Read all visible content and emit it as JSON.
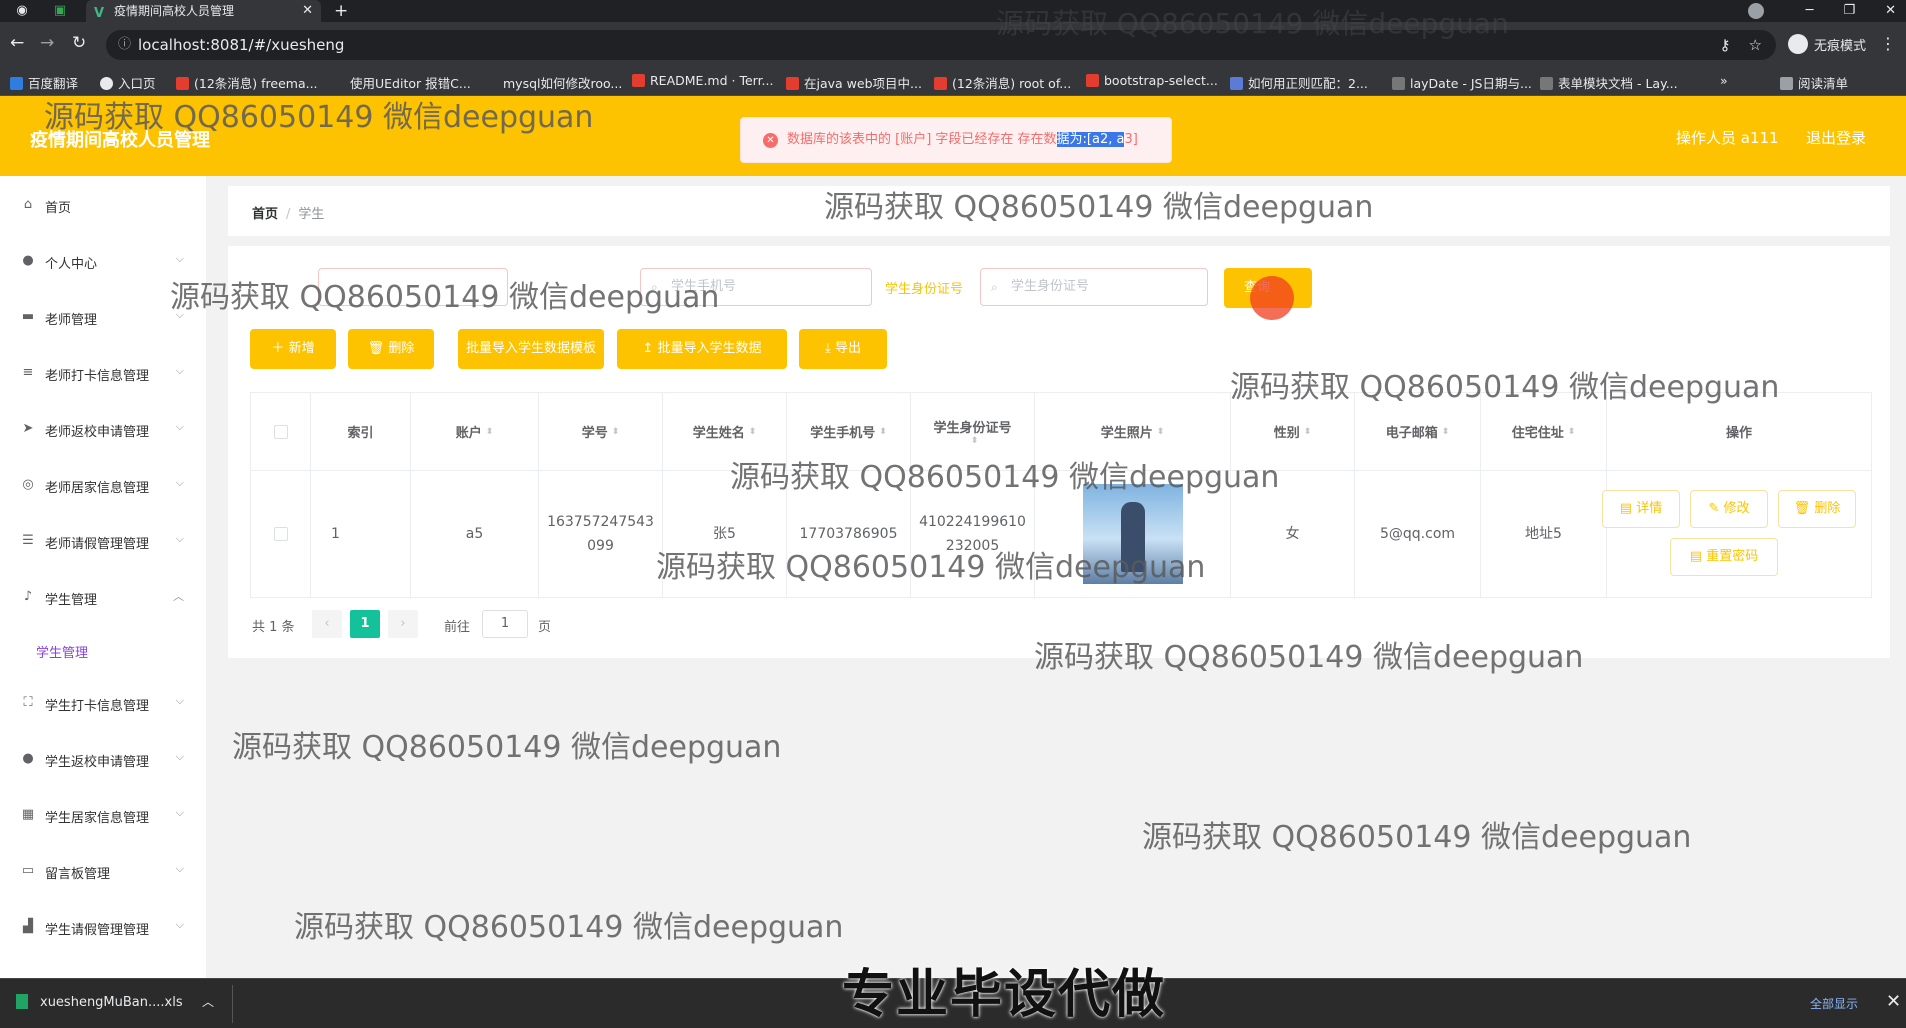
{
  "browser": {
    "tab_title": "疫情期间高校人员管理",
    "url": "localhost:8081/#/xuesheng",
    "incognito_label": "无痕模式",
    "bookmarks": [
      "百度翻译",
      "入口页",
      "(12条消息) freema...",
      "使用UEditor 报错C...",
      "mysql如何修改roo...",
      "README.md · Terr...",
      "在java web项目中...",
      "(12条消息) root of...",
      "bootstrap-select...",
      "如何用正则匹配：2...",
      "layDate - JS日期与...",
      "表单模块文档 - Lay..."
    ],
    "reading_list": "阅读清单"
  },
  "header": {
    "title": "疫情期间高校人员管理",
    "operator": "操作人员 a111",
    "logout": "退出登录"
  },
  "alert": {
    "text_before": "数据库的该表中的 [账户] 字段已经存在 存在数",
    "text_selected": "据为:[a2, a",
    "text_after": "3]"
  },
  "sidebar": {
    "items": [
      {
        "label": "首页",
        "icon": "home-icon"
      },
      {
        "label": "个人中心",
        "icon": "user-icon"
      },
      {
        "label": "老师管理",
        "icon": "monitor-icon"
      },
      {
        "label": "老师打卡信息管理",
        "icon": "sliders-icon"
      },
      {
        "label": "老师返校申请管理",
        "icon": "send-icon"
      },
      {
        "label": "老师居家信息管理",
        "icon": "globe-icon"
      },
      {
        "label": "老师请假管理管理",
        "icon": "list-icon"
      },
      {
        "label": "学生管理",
        "icon": "mic-icon"
      },
      {
        "label": "学生管理",
        "icon": ""
      },
      {
        "label": "学生打卡信息管理",
        "icon": "frame-icon"
      },
      {
        "label": "学生返校申请管理",
        "icon": "user-icon"
      },
      {
        "label": "学生居家信息管理",
        "icon": "grid-icon"
      },
      {
        "label": "留言板管理",
        "icon": "message-icon"
      },
      {
        "label": "学生请假管理管理",
        "icon": "thumb-icon"
      }
    ]
  },
  "breadcrumb": {
    "home": "首页",
    "current": "学生"
  },
  "search": {
    "phone_placeholder": "学生手机号",
    "id_label": "学生身份证号",
    "id_placeholder": "学生身份证号",
    "query_button": "查询"
  },
  "actions": {
    "add": "新增",
    "delete": "删除",
    "template": "批量导入学生数据模板",
    "import": "批量导入学生数据",
    "export": "导出"
  },
  "table": {
    "headers": [
      "索引",
      "账户",
      "学号",
      "学生姓名",
      "学生手机号",
      "学生身份证号",
      "学生照片",
      "性别",
      "电子邮箱",
      "住宅住址",
      "操作"
    ],
    "rows": [
      {
        "index": "1",
        "account": "a5",
        "student_no": "163757247543 099",
        "name": "张5",
        "phone": "17703786905",
        "id_card": "410224199610 232005",
        "gender": "女",
        "email": "5@qq.com",
        "address": "地址5"
      }
    ],
    "row_actions": {
      "detail": "详情",
      "edit": "修改",
      "delete": "删除",
      "reset": "重置密码"
    }
  },
  "pagination": {
    "total": "共 1 条",
    "current_page": "1",
    "goto_label": "前往",
    "goto_value": "1",
    "page_suffix": "页"
  },
  "download": {
    "file_name": "xueshengMuBan....xls",
    "show_all": "全部显示"
  },
  "overlay": {
    "watermark": "源码获取 QQ86050149 微信deepguan",
    "promo": "专业毕设代做"
  },
  "colors": {
    "accent": "#fec300",
    "page_active": "#13c29a",
    "error": "#f56c6c"
  }
}
